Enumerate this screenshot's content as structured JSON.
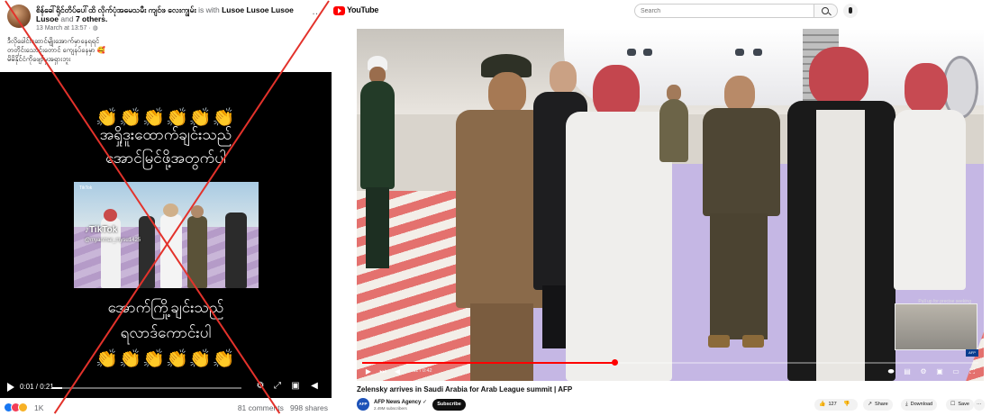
{
  "facebook": {
    "author": "စိန်ခေါ်ရိုင်တိပ်ပေါ်ထိ လိုက်ပုံအမေသမီး ကျင်ဖ လေးကျွမ်း",
    "with_text": "is with",
    "tagged": "Lusoe Lusoe Lusoe Lusoe",
    "and_text": "and",
    "others": "7 others.",
    "more_icon": "…",
    "timestamp": "13 March at 13:57 · ",
    "audience_icon": "globe-icon",
    "text_lines": [
      "ဒီလိုခေါင်းဆောင်မျိုးအောက်မှာနေရရင်",
      "တတိုင်းသောင်းတောင် ကျေနပ်နေမှာ 🥰",
      "မိမိနိုင်ငံကိုဖျော်မှအရှားဘူး"
    ],
    "video": {
      "wave_emoji_top": "👏👏👏👏👏👏",
      "caption_top_1": "အရှိုဒူးထောက်ချင်းသည်",
      "caption_top_2": "အောင်မြင်ဖို့အတွက်ပါ",
      "tiktok_label": "TikTok",
      "tiktok_handle": "@myanmar_mysu1425",
      "tiktok_small": "TikTok",
      "caption_bottom_1": "အောက်ကြို့ချင်းသည်",
      "caption_bottom_2": "ရလာဒ်ကောင်းပါ",
      "wave_emoji_bottom": "👏👏👏👏👏👏",
      "time": "0:01 / 0:21",
      "progress": 0.05
    },
    "reaction_count": "1K",
    "comments": "81 comments",
    "shares": "998 shares"
  },
  "youtube": {
    "logo_text": "YouTube",
    "search_placeholder": "Search",
    "search_icon": "search-icon",
    "mic_icon": "mic-icon",
    "player": {
      "time": "0:11 / 0:42",
      "progress": 0.41,
      "corner_text": "Pull up for precise seeking",
      "afp_badge": "AFP"
    },
    "video_title": "Zelensky arrives in Saudi Arabia for Arab League summit | AFP",
    "channel": {
      "avatar_text": "AFP",
      "name": "AFP News Agency",
      "verified_icon": "✓",
      "subscribers": "2.49M subscribers",
      "subscribe_label": "Subscribe"
    },
    "actions": {
      "likes": "127",
      "share": "Share",
      "download": "Download",
      "save": "Save",
      "more": "···"
    }
  },
  "colors": {
    "cross": "#e3322b",
    "yt_red": "#ff0000",
    "emoji_gold": "#f6b63a"
  }
}
